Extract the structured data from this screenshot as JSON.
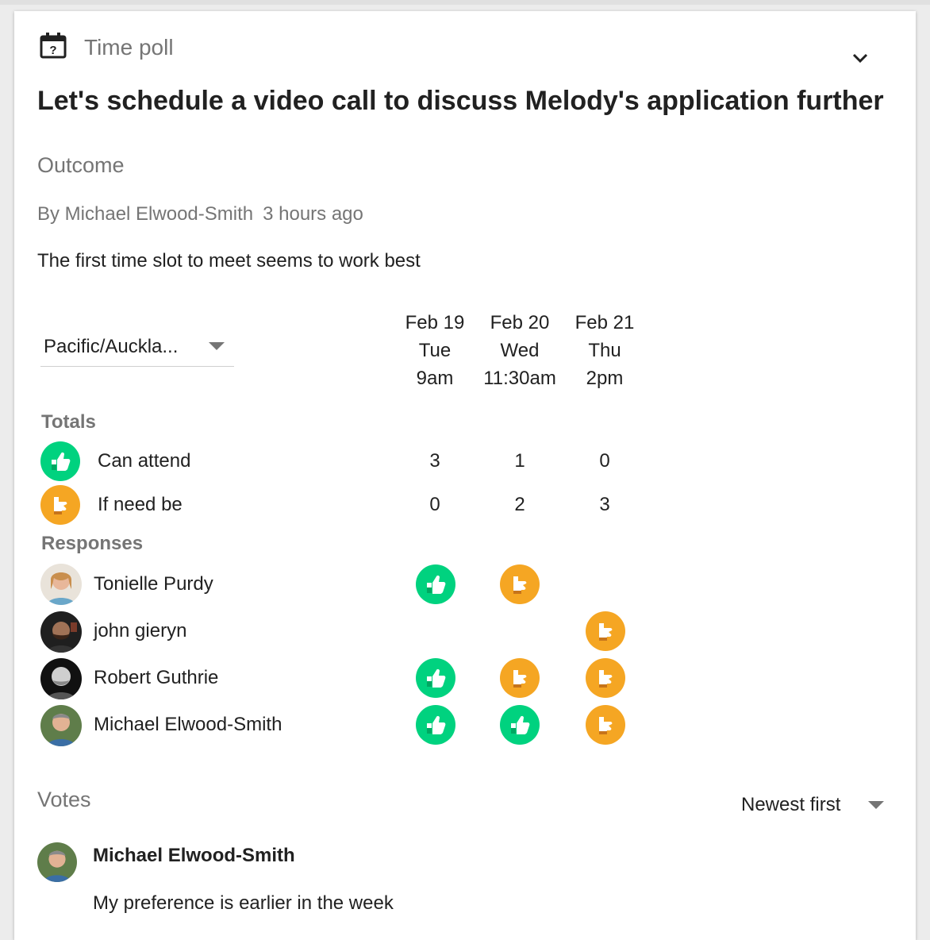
{
  "header": {
    "poll_type": "Time poll",
    "title": "Let's schedule a video call to discuss Melody's application further"
  },
  "outcome": {
    "heading": "Outcome",
    "author": "By Michael Elwood-Smith",
    "time_ago": "3 hours ago",
    "statement": "The first time slot to meet seems to work best"
  },
  "timezone": {
    "value": "Pacific/Auckla..."
  },
  "columns": [
    {
      "date": "Feb 19",
      "day": "Tue",
      "time": "9am"
    },
    {
      "date": "Feb 20",
      "day": "Wed",
      "time": "11:30am"
    },
    {
      "date": "Feb 21",
      "day": "Thu",
      "time": "2pm"
    }
  ],
  "totals": {
    "heading": "Totals",
    "can_attend": {
      "label": "Can attend",
      "values": [
        "3",
        "1",
        "0"
      ]
    },
    "if_need_be": {
      "label": "If need be",
      "values": [
        "0",
        "2",
        "3"
      ]
    }
  },
  "responses": {
    "heading": "Responses",
    "people": [
      {
        "name": "Tonielle Purdy",
        "votes": [
          "yes",
          "maybe",
          ""
        ]
      },
      {
        "name": "john gieryn",
        "votes": [
          "",
          "",
          "maybe"
        ]
      },
      {
        "name": "Robert Guthrie",
        "votes": [
          "yes",
          "maybe",
          "maybe"
        ]
      },
      {
        "name": "Michael Elwood-Smith",
        "votes": [
          "yes",
          "yes",
          "maybe"
        ]
      }
    ]
  },
  "votes": {
    "heading": "Votes",
    "sort": "Newest first",
    "items": [
      {
        "name": "Michael Elwood-Smith",
        "text": "My preference is earlier in the week"
      }
    ]
  },
  "colors": {
    "yes": "#00d27f",
    "maybe": "#f5a623",
    "muted": "#757575"
  },
  "icons": {
    "poll": "calendar-question-icon",
    "expand": "chevron-down-icon",
    "yes": "thumbs-up-icon",
    "maybe": "hand-point-icon"
  }
}
